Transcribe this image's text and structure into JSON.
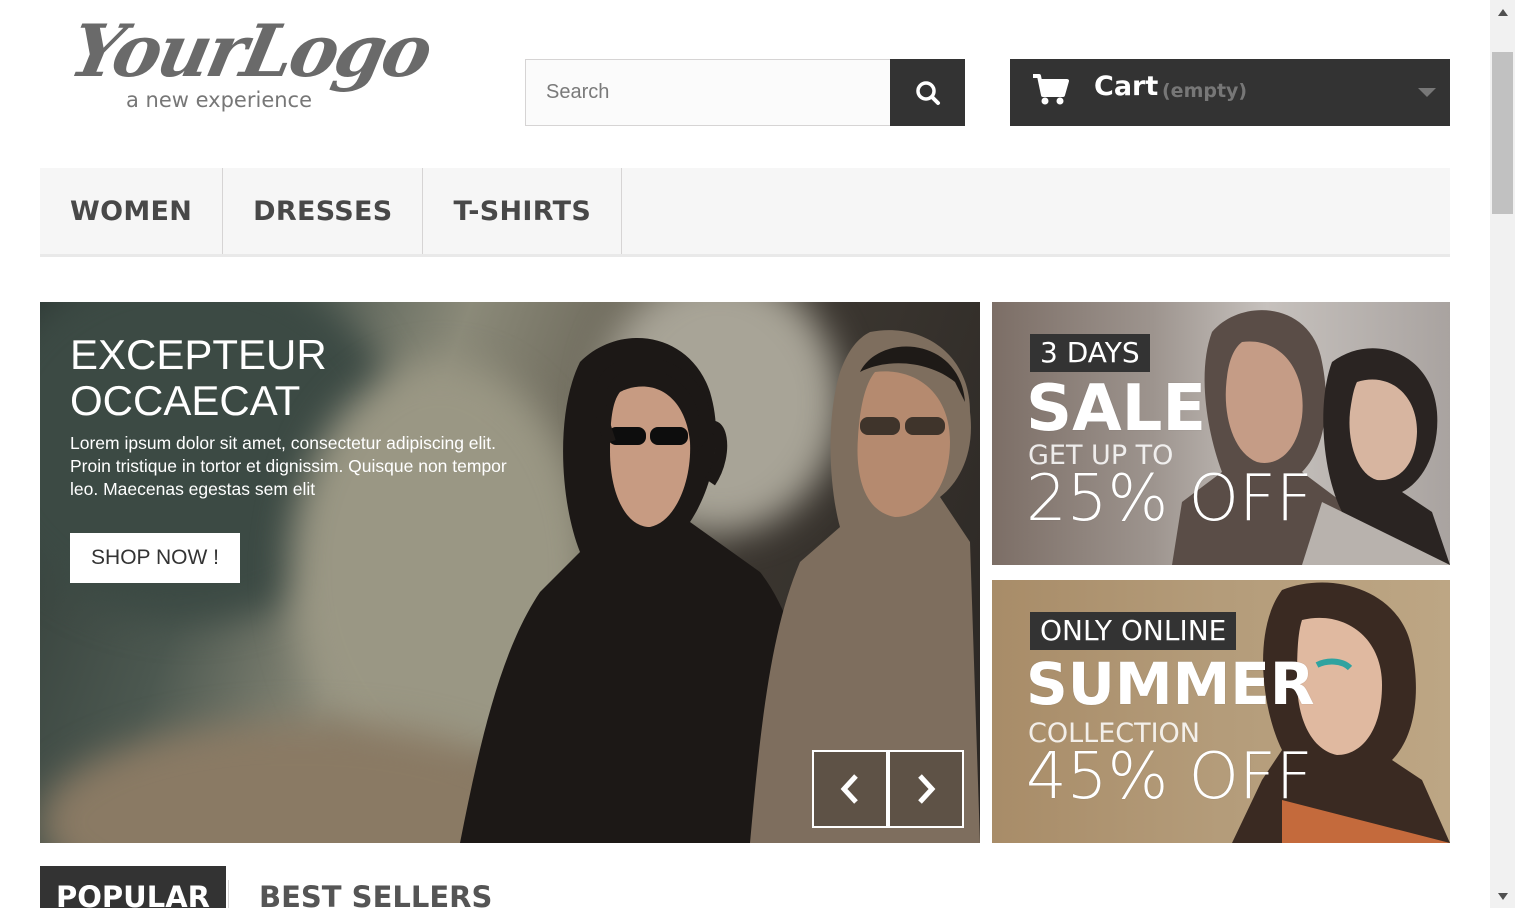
{
  "logo": {
    "text": "YourLogo",
    "tagline": "a new experience"
  },
  "search": {
    "placeholder": "Search",
    "value": "",
    "button_icon": "search-icon"
  },
  "cart": {
    "label": "Cart",
    "status": "(empty)",
    "icon": "shopping-cart-icon",
    "caret_icon": "caret-down-icon"
  },
  "menu": {
    "items": [
      {
        "label": "WOMEN"
      },
      {
        "label": "DRESSES"
      },
      {
        "label": "T-SHIRTS"
      }
    ]
  },
  "slider": {
    "title": "EXCEPTEUR OCCAECAT",
    "text": "Lorem ipsum dolor sit amet, consectetur adipiscing elit. Proin tristique in tortor et dignissim. Quisque non tempor leo. Maecenas egestas sem elit",
    "button_label": "SHOP NOW !",
    "prev_icon": "chevron-left-icon",
    "next_icon": "chevron-right-icon"
  },
  "banners": [
    {
      "tag": "3 DAYS",
      "headline": "SALE",
      "subline": "GET UP TO",
      "offer": "25% OFF"
    },
    {
      "tag": "ONLY ONLINE",
      "headline": "SUMMER",
      "subline": "COLLECTION",
      "offer": "45% OFF"
    }
  ],
  "tabs": [
    {
      "label": "POPULAR",
      "active": true
    },
    {
      "label": "BEST SELLERS",
      "active": false
    }
  ],
  "colors": {
    "dark": "#333333",
    "menu_bg": "#f6f6f6",
    "white": "#ffffff"
  }
}
